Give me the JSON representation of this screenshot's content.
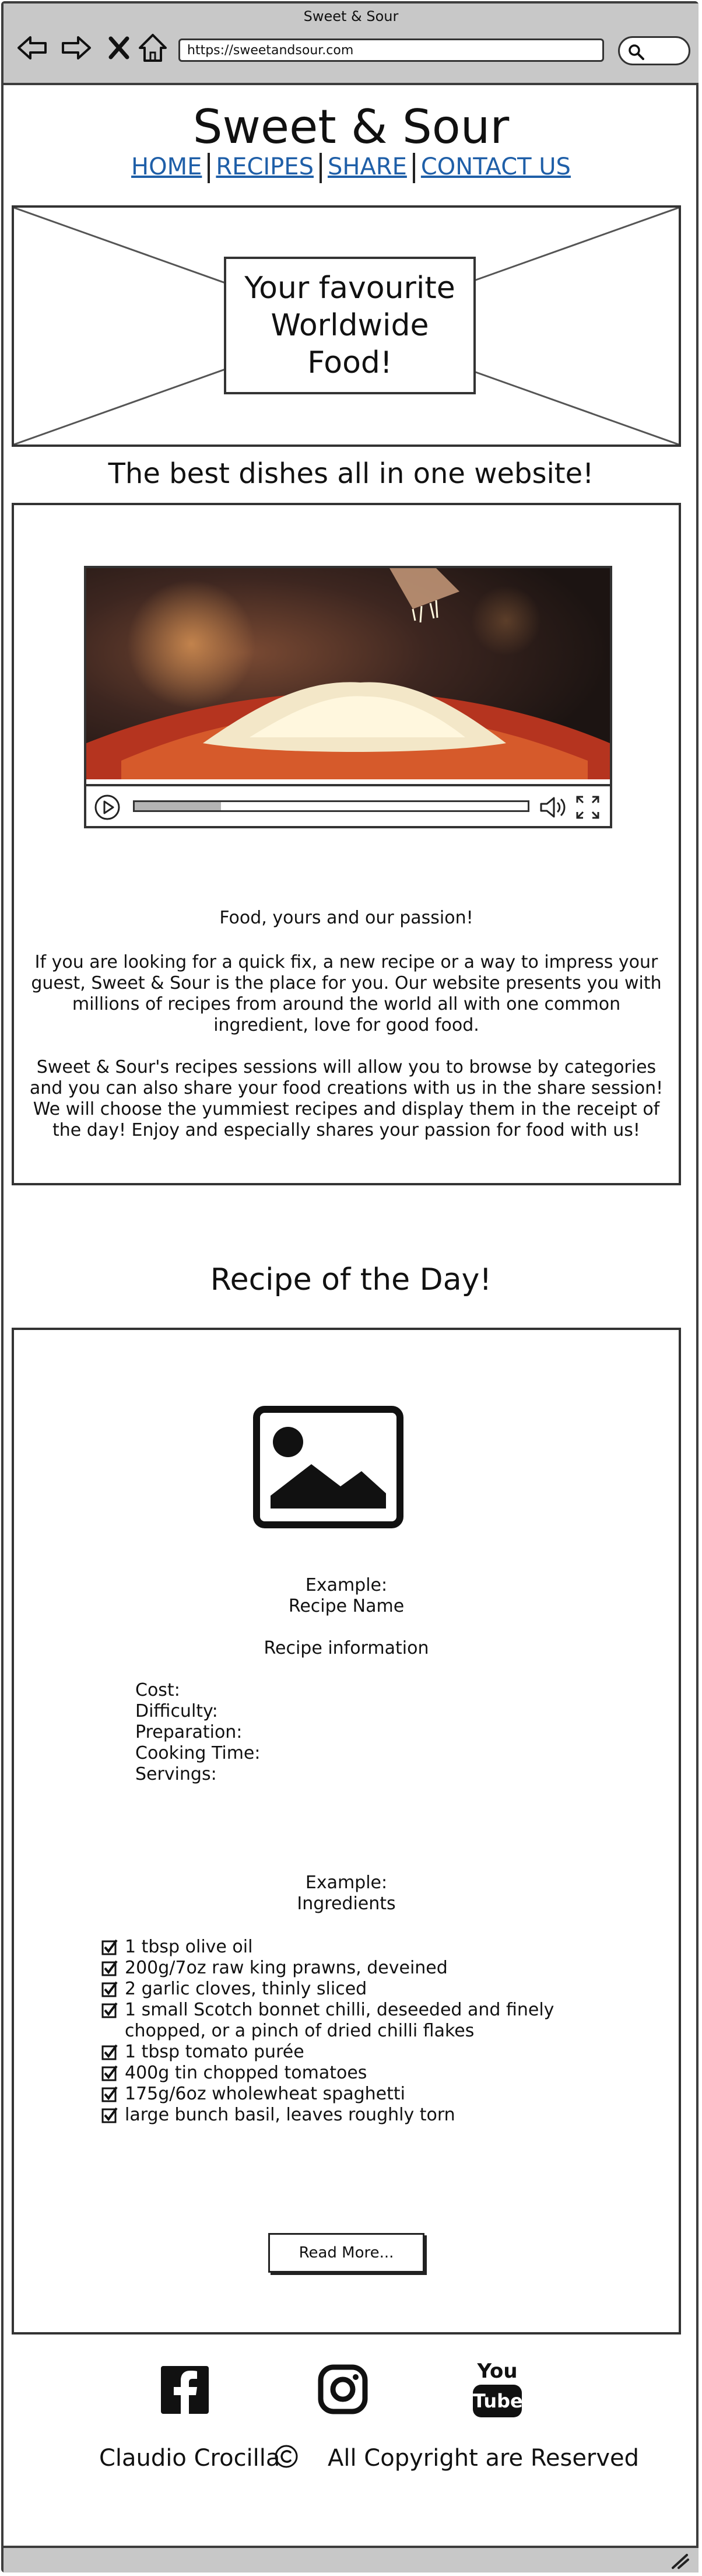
{
  "browser": {
    "title": "Sweet & Sour",
    "url": "https://sweetandsour.com",
    "icons": [
      "back-arrow-icon",
      "forward-arrow-icon",
      "close-icon",
      "home-icon",
      "search-icon"
    ]
  },
  "header": {
    "site_title": "Sweet & Sour",
    "nav": [
      {
        "label": "HOME"
      },
      {
        "label": "RECIPES"
      },
      {
        "label": "SHARE"
      },
      {
        "label": "CONTACT US"
      }
    ]
  },
  "hero": {
    "text": "Your favourite Worldwide Food!"
  },
  "tagline": "The best dishes all in one website!",
  "video": {
    "progress_fraction": 0.22,
    "controls": [
      "play-icon",
      "volume-icon",
      "fullscreen-icon"
    ]
  },
  "about": {
    "lead": "Food, yours and our passion!",
    "paragraph1": "If you are looking for a quick fix, a new recipe or a way to impress your guest, Sweet & Sour is the place for you. Our website presents you with millions of recipes from around the world all with one common ingredient, love for good food.",
    "paragraph2": "Sweet & Sour's recipes sessions will allow you to browse by categories and you can also share your food creations with us in the share session! We will choose the yummiest recipes and display them in the receipt of the day! Enjoy and especially shares your passion for food with us!"
  },
  "recipe_of_day": {
    "title": "Recipe of the Day!",
    "example_label": "Example:",
    "recipe_name": "Recipe Name",
    "info_heading": "Recipe information",
    "meta": [
      "Cost:",
      "Difficulty:",
      "Preparation:",
      "Cooking Time:",
      "Servings:"
    ],
    "ingredients_example_label": "Example:",
    "ingredients_heading": "Ingredients",
    "ingredients": [
      "1 tbsp olive oil",
      "200g/7oz raw king prawns, deveined",
      "2 garlic cloves, thinly sliced",
      "1 small Scotch bonnet chilli, deseeded and finely chopped, or a pinch of dried chilli flakes",
      "1 tbsp tomato purée",
      "400g tin chopped tomatoes",
      "175g/6oz wholewheat spaghetti",
      "large bunch basil, leaves roughly torn"
    ],
    "read_more": "Read More..."
  },
  "footer": {
    "social": [
      "facebook-icon",
      "instagram-icon",
      "youtube-icon"
    ],
    "youtube_label_top": "You",
    "youtube_label_bottom": "Tube",
    "author": "Claudio Crocilla",
    "copyright": "All Copyright are Reserved"
  }
}
